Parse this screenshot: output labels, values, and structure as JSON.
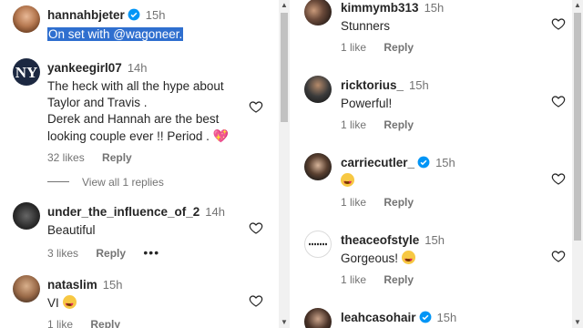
{
  "left": {
    "post": {
      "username": "hannahbjeter",
      "time": "15h",
      "caption": "On set with @wagoneer."
    },
    "comments": [
      {
        "username": "yankeegirl07",
        "time": "14h",
        "lines": [
          "The heck with all the hype about",
          "Taylor and Travis .",
          "Derek and Hannah are the best",
          "looking couple ever !! Period ."
        ],
        "likes": "32 likes",
        "reply": "Reply",
        "view_replies": "View all 1 replies"
      },
      {
        "username": "under_the_influence_of_2",
        "time": "14h",
        "text": "Beautiful",
        "likes": "3 likes",
        "reply": "Reply",
        "more": "•••"
      },
      {
        "username": "nataslim",
        "time": "15h",
        "text": "VI",
        "likes": "1 like",
        "reply": "Reply"
      }
    ]
  },
  "right": {
    "comments": [
      {
        "username": "kimmymb313",
        "time": "15h",
        "text": "Stunners",
        "likes": "1 like",
        "reply": "Reply"
      },
      {
        "username": "ricktorius_",
        "time": "15h",
        "text": "Powerful!",
        "likes": "1 like",
        "reply": "Reply"
      },
      {
        "username": "carriecutler_",
        "time": "15h",
        "text": "",
        "likes": "1 like",
        "reply": "Reply"
      },
      {
        "username": "theaceofstyle",
        "time": "15h",
        "text": "Gorgeous!",
        "likes": "1 like",
        "reply": "Reply"
      },
      {
        "username": "leahcasohair",
        "time": "15h",
        "text": ""
      }
    ]
  },
  "colors": {
    "verified": "#0095f6",
    "highlight": "#2f6fcf",
    "secondary_text": "#737373"
  },
  "icons": [
    "verified-badge-icon",
    "heart-outline-icon",
    "heart-emoji-icon",
    "heart-eyes-emoji-icon"
  ]
}
